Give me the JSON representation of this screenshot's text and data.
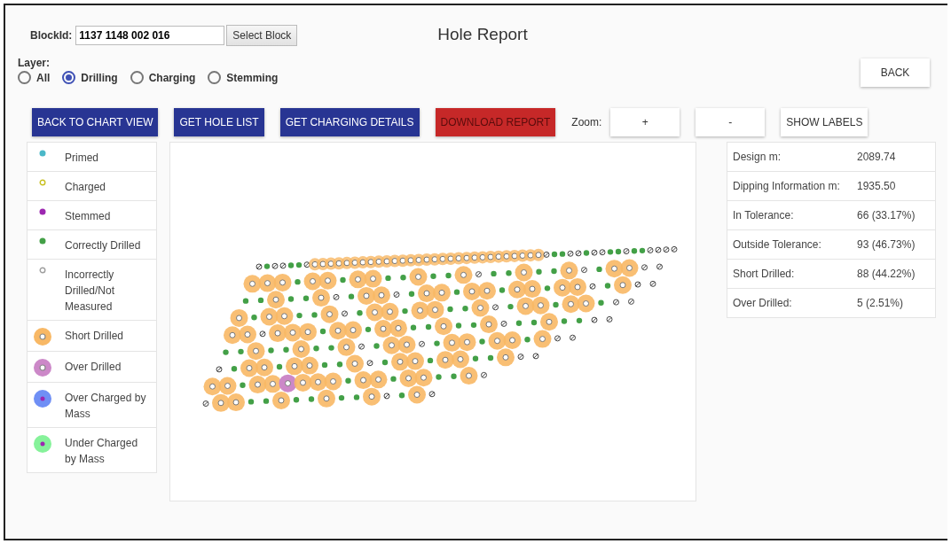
{
  "title": "Hole Report",
  "block": {
    "label": "BlockId:",
    "value": "1137 1148 002 016",
    "button": "Select Block"
  },
  "back_button": "BACK",
  "layer": {
    "label": "Layer:",
    "options": [
      {
        "label": "All",
        "selected": false
      },
      {
        "label": "Drilling",
        "selected": true
      },
      {
        "label": "Charging",
        "selected": false
      },
      {
        "label": "Stemming",
        "selected": false
      }
    ]
  },
  "toolbar": {
    "buttons": [
      {
        "label": "BACK TO CHART VIEW",
        "kind": "primary"
      },
      {
        "label": "GET HOLE LIST",
        "kind": "primary"
      },
      {
        "label": "GET CHARGING DETAILS",
        "kind": "primary"
      },
      {
        "label": "DOWNLOAD REPORT",
        "kind": "danger"
      }
    ],
    "zoom_label": "Zoom:",
    "zoom_buttons": [
      {
        "label": "+",
        "kind": "plain"
      },
      {
        "label": "-",
        "kind": "plain"
      },
      {
        "label": "SHOW LABELS",
        "kind": "plain"
      }
    ]
  },
  "legend": [
    {
      "label": "Primed",
      "kind": "dot",
      "color": "#4bb8c8"
    },
    {
      "label": "Charged",
      "kind": "ring",
      "color": "#c8c020"
    },
    {
      "label": "Stemmed",
      "kind": "dot",
      "color": "#9c27b0"
    },
    {
      "label": "Correctly Drilled",
      "kind": "dot",
      "color": "#43a047"
    },
    {
      "label": "Incorrectly Drilled/Not Measured",
      "kind": "ring",
      "color": "#9e9e9e"
    },
    {
      "label": "Short Drilled",
      "kind": "halo-ring",
      "color": "#f8b865"
    },
    {
      "label": "Over Drilled",
      "kind": "halo-ring",
      "color": "#cc88c8"
    },
    {
      "label": "Over Charged by Mass",
      "kind": "halo-dot",
      "color": "#6f8ff5"
    },
    {
      "label": "Under Charged by Mass",
      "kind": "halo-dot",
      "color": "#86f29a"
    }
  ],
  "stats": [
    {
      "label": "Design m:",
      "value": "2089.74"
    },
    {
      "label": "Dipping Information m:",
      "value": "1935.50"
    },
    {
      "label": "In Tolerance:",
      "value": "66 (33.17%)"
    },
    {
      "label": "Outside Tolerance:",
      "value": "93 (46.73%)"
    },
    {
      "label": "Short Drilled:",
      "value": "88 (44.22%)"
    },
    {
      "label": "Over Drilled:",
      "value": "5 (2.51%)"
    }
  ]
}
